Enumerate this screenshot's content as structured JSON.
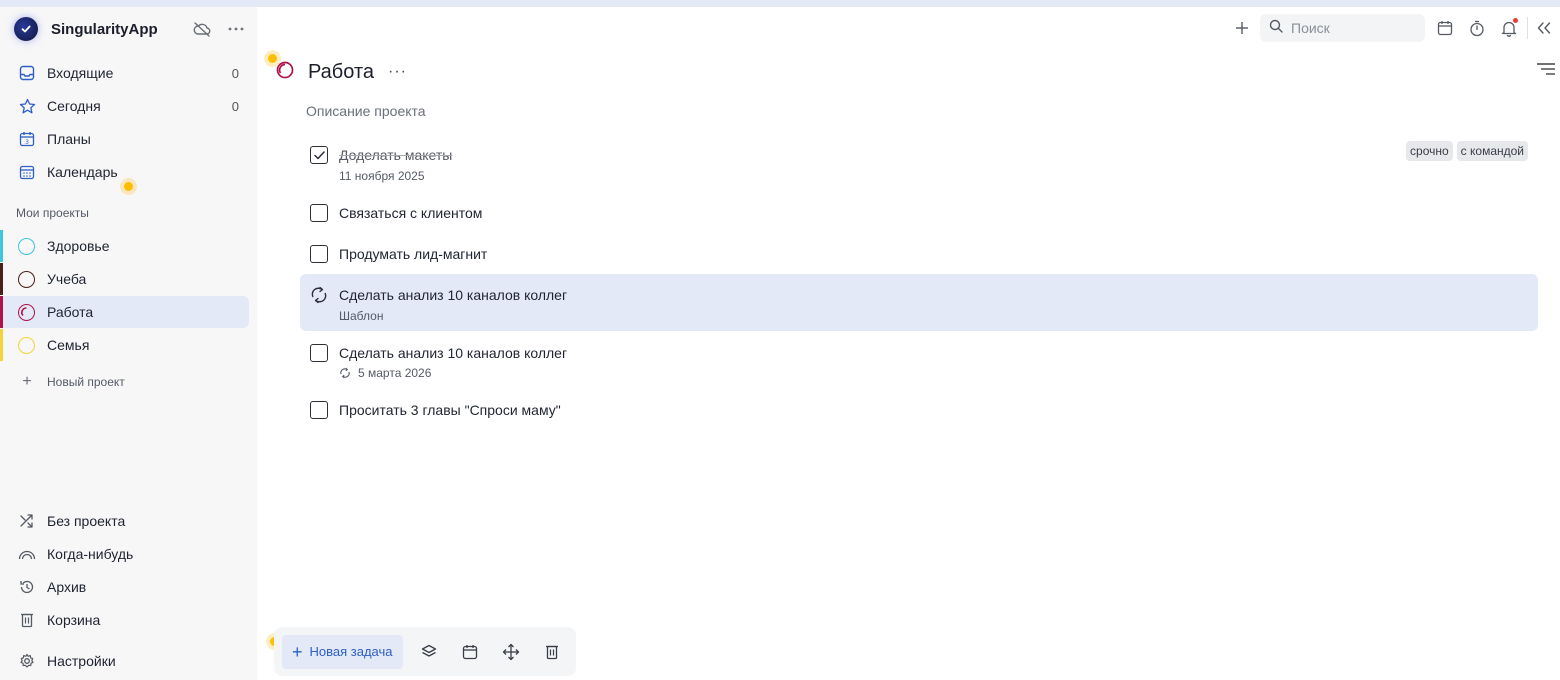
{
  "app": {
    "name": "SingularityApp"
  },
  "sidebar": {
    "items": [
      {
        "label": "Входящие",
        "count": "0",
        "icon": "inbox-icon"
      },
      {
        "label": "Сегодня",
        "count": "0",
        "icon": "star-icon"
      },
      {
        "label": "Планы",
        "icon": "plans-calendar-icon"
      },
      {
        "label": "Календарь",
        "icon": "calendar-grid-icon"
      }
    ],
    "projects_title": "Мои проекты",
    "projects": [
      {
        "label": "Здоровье",
        "color": "#3ec5e0"
      },
      {
        "label": "Учеба",
        "color": "#4a2018"
      },
      {
        "label": "Работа",
        "color": "#b0124a",
        "active": true
      },
      {
        "label": "Семья",
        "color": "#f5d33b"
      }
    ],
    "new_project": "Новый проект",
    "bottom": [
      {
        "label": "Без проекта",
        "icon": "shuffle-icon"
      },
      {
        "label": "Когда-нибудь",
        "icon": "rainbow-icon"
      },
      {
        "label": "Архив",
        "icon": "history-icon"
      },
      {
        "label": "Корзина",
        "icon": "trash-icon"
      },
      {
        "label": "Настройки",
        "icon": "settings-gear-icon"
      }
    ]
  },
  "topbar": {
    "search_placeholder": "Поиск"
  },
  "project": {
    "title": "Работа",
    "more": "···",
    "description": "Описание проекта"
  },
  "tasks": [
    {
      "title": "Доделать макеты",
      "sub": "11 ноября 2025",
      "done": true,
      "tags": [
        "срочно",
        "с командой"
      ]
    },
    {
      "title": "Связаться с клиентом"
    },
    {
      "title": "Продумать лид-магнит"
    },
    {
      "title": "Сделать анализ 10 каналов коллег",
      "sub": "Шаблон",
      "template": true,
      "selected": true
    },
    {
      "title": "Сделать анализ 10 каналов коллег",
      "sub": "5 марта 2026",
      "repeat": true
    },
    {
      "title": "Проситать 3 главы \"Спроси маму\""
    }
  ],
  "toolbar": {
    "new_task_label": "Новая задача"
  },
  "colors": {
    "accent": "#2d5fc7",
    "selected_bg": "#e3e9f7",
    "highlight_dot": "#ffbf00"
  }
}
